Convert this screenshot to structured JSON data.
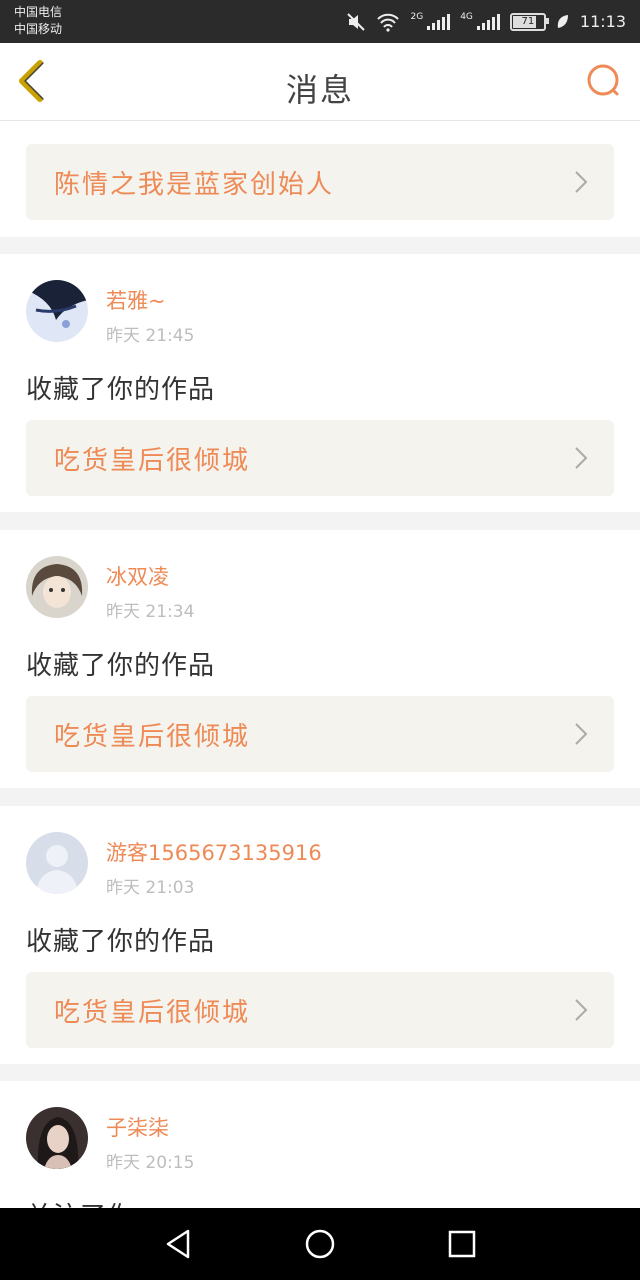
{
  "status_bar": {
    "carrier1": "中国电信",
    "carrier2": "中国移动",
    "net1": "2G",
    "net2": "4G",
    "battery": "71",
    "time": "11:13"
  },
  "header": {
    "title": "消息",
    "back_icon": "chevron-left-icon",
    "search_icon": "search-icon"
  },
  "partial_item": {
    "work_title": "陈情之我是蓝家创始人"
  },
  "notifications": [
    {
      "user": "若雅~",
      "time": "昨天 21:45",
      "action": "收藏了你的作品",
      "work_title": "吃货皇后很倾城"
    },
    {
      "user": "冰双凌",
      "time": "昨天 21:34",
      "action": "收藏了你的作品",
      "work_title": "吃货皇后很倾城"
    },
    {
      "user": "游客15656731359​16",
      "time": "昨天 21:03",
      "action": "收藏了你的作品",
      "work_title": "吃货皇后很倾城"
    },
    {
      "user": "子柒柒",
      "time": "昨天 20:15",
      "action": "关注了你"
    }
  ],
  "colors": {
    "accent": "#ee8a56",
    "back_icon": "#c9a200",
    "work_box_bg": "#f4f3ee",
    "separator": "#f3f3f3"
  }
}
